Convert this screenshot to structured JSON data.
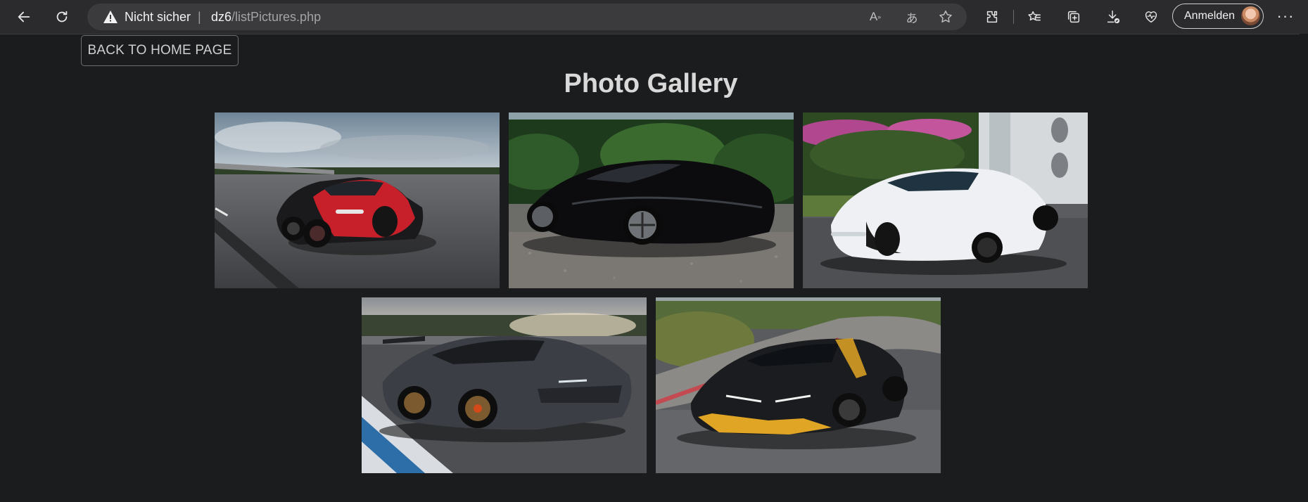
{
  "browser": {
    "security_label": "Nicht sicher",
    "separator": "|",
    "url_host": "dz6",
    "url_path": "/listPictures.php",
    "signin_label": "Anmelden",
    "more_label": "···",
    "icons": [
      "back-arrow-icon",
      "refresh-icon",
      "warning-icon",
      "read-aloud-icon",
      "translate-icon",
      "favorite-star-icon",
      "extensions-icon",
      "favorites-icon",
      "collections-icon",
      "downloads-icon",
      "browser-essentials-icon"
    ]
  },
  "page": {
    "back_button": "BACK TO HOME PAGE",
    "title": "Photo Gallery",
    "photos": [
      {
        "subject": "red and black Bugatti Chiron on track",
        "accent": "#d2232a"
      },
      {
        "subject": "black Bugatti La Voiture Noire",
        "accent": "#111111"
      },
      {
        "subject": "white Bugatti Chiron Super Sport",
        "accent": "#eef0f3"
      },
      {
        "subject": "grey Lamborghini Aventador SVJ",
        "accent": "#55585e"
      },
      {
        "subject": "black and yellow Lamborghini Centenario",
        "accent": "#e0a524"
      }
    ]
  },
  "colors": {
    "background": "#1b1c1e",
    "toolbar": "#2b2b2d",
    "addressbar": "#3b3b3e",
    "title_text": "#d9d9d9"
  }
}
